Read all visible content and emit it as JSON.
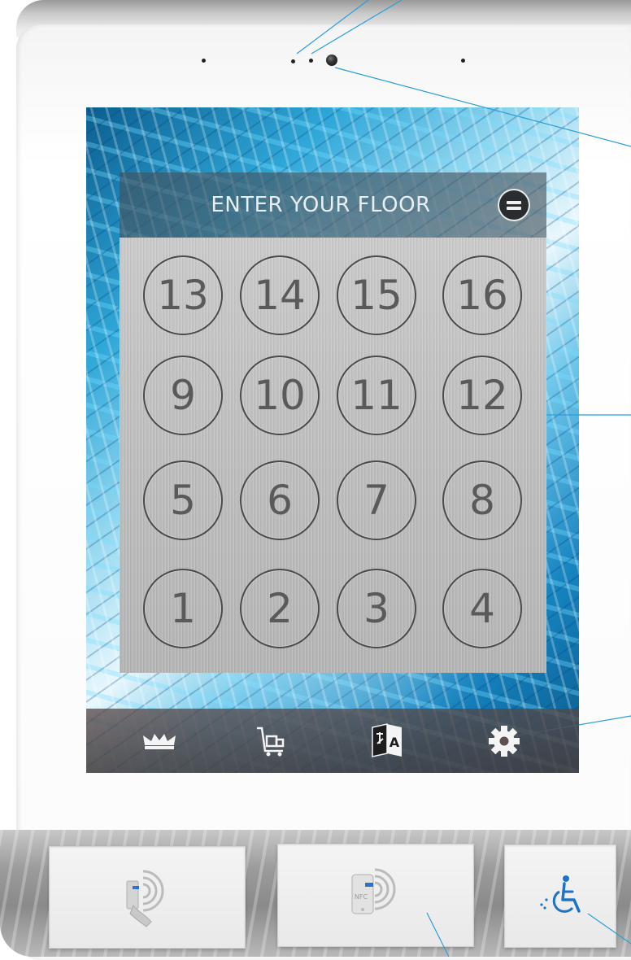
{
  "keypad": {
    "title": "ENTER YOUR FLOOR",
    "menu_icon": "menu-icon",
    "floors": [
      [
        "13",
        "14",
        "15",
        "16"
      ],
      [
        "9",
        "10",
        "11",
        "12"
      ],
      [
        "5",
        "6",
        "7",
        "8"
      ],
      [
        "1",
        "2",
        "3",
        "4"
      ]
    ]
  },
  "toolbar": {
    "icons": [
      "crown-icon",
      "delivery-trolley-icon",
      "language-translate-icon",
      "gear-icon"
    ],
    "translate_label": "A"
  },
  "readers": {
    "card_icon": "contactless-card-icon",
    "nfc_icon": "nfc-phone-icon",
    "nfc_label": "NFC",
    "accessibility_icon": "wheelchair-icon"
  },
  "colors": {
    "screen_blue": "#2fa7d8",
    "callout_line": "#2a9fd6",
    "accessibility_blue": "#1e73c8"
  }
}
